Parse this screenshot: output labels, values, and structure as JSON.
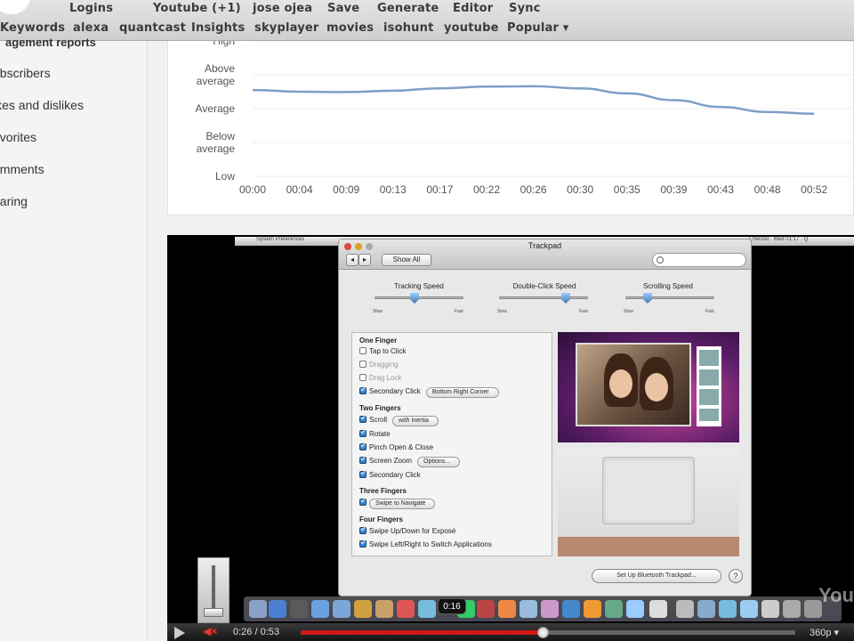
{
  "bookmarks": {
    "row1": [
      "Logins",
      "Youtube (+1)",
      "jose ojea",
      "Save",
      "Generate",
      "Editor",
      "Sync"
    ],
    "row2": [
      "Keywords",
      "alexa",
      "quantcast",
      "Insights",
      "skyplayer",
      "movies",
      "isohunt",
      "youtube",
      "Popular ▾"
    ]
  },
  "sidebar": {
    "heading": "agement reports",
    "items": [
      "ubscribers",
      "ikes and dislikes",
      "avorites",
      "omments",
      "haring"
    ]
  },
  "chart_data": {
    "type": "line",
    "title": "",
    "xlabel": "",
    "ylabel": "",
    "y_categories": [
      "Low",
      "Below average",
      "Average",
      "Above average",
      "High"
    ],
    "y_tick_labels": [
      "High",
      "Above\naverage",
      "Average",
      "Below\naverage",
      "Low"
    ],
    "x": [
      "00:00",
      "00:04",
      "00:09",
      "00:13",
      "00:17",
      "00:22",
      "00:26",
      "00:30",
      "00:35",
      "00:39",
      "00:43",
      "00:48",
      "00:52"
    ],
    "series": [
      {
        "values": [
          2.55,
          2.5,
          2.49,
          2.53,
          2.6,
          2.65,
          2.66,
          2.6,
          2.45,
          2.25,
          2.05,
          1.9,
          1.85
        ]
      }
    ],
    "ylim": [
      0,
      4
    ],
    "grid": true,
    "line_color": "#7e9fc8"
  },
  "player": {
    "screen": {
      "menubar_left": "System Preferences",
      "menubar_right": "Chenzel · Wed 01:17 · Q",
      "window_title": "Trackpad",
      "show_all": "Show All",
      "nav_back": "◂",
      "nav_fwd": "▸",
      "sliders": [
        {
          "label": "Tracking Speed",
          "min": "Slow",
          "max": "Fast",
          "value": 0.45
        },
        {
          "label": "Double-Click Speed",
          "min": "Slow",
          "max": "Fast",
          "value": 0.75
        },
        {
          "label": "Scrolling Speed",
          "min": "Slow",
          "max": "Fast",
          "value": 0.25
        }
      ],
      "sections": {
        "one": "One Finger",
        "two": "Two Fingers",
        "three": "Three Fingers",
        "four": "Four Fingers"
      },
      "gestures": {
        "tap": "Tap to Click",
        "dragging": "Dragging",
        "drag_lock": "Drag Lock",
        "secondary1": "Secondary Click",
        "secondary1_opt": "Bottom Right Corner",
        "scroll": "Scroll",
        "scroll_opt": "with Inertia",
        "rotate": "Rotate",
        "pinch": "Pinch Open & Close",
        "zoom": "Screen Zoom",
        "zoom_opt": "Options...",
        "secondary2": "Secondary Click",
        "swipe": "Swipe to Navigate",
        "swipe_updown": "Swipe Up/Down for Exposé",
        "swipe_leftright": "Swipe Left/Right to Switch Applications"
      },
      "bluetooth_button": "Set Up Bluetooth Trackpad...",
      "help_button": "?"
    },
    "hover_time": "0:16",
    "watermark": "You",
    "time_current": "0:26",
    "time_sep": " / ",
    "time_total": "0:53",
    "progress": 0.49,
    "quality": "360p ▾",
    "mute_icon": "◀×"
  }
}
